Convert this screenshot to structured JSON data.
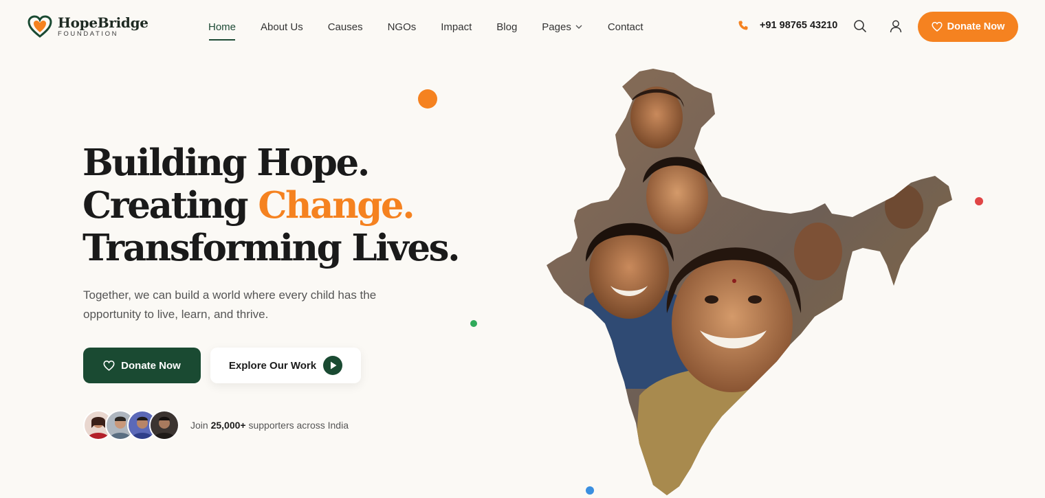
{
  "brand": {
    "name": "HopeBridge",
    "tagline": "FOUNDATION",
    "primary_color": "#1a4a32",
    "accent_color": "#f58220"
  },
  "nav": {
    "items": [
      {
        "label": "Home",
        "active": true
      },
      {
        "label": "About Us"
      },
      {
        "label": "Causes"
      },
      {
        "label": "NGOs"
      },
      {
        "label": "Impact"
      },
      {
        "label": "Blog"
      },
      {
        "label": "Pages",
        "has_dropdown": true
      },
      {
        "label": "Contact"
      }
    ]
  },
  "header": {
    "phone": "+91 98765 43210",
    "icons": [
      "phone-icon",
      "search-icon",
      "user-icon"
    ],
    "donate_label": "Donate Now"
  },
  "hero": {
    "title_line1": "Building Hope.",
    "title_line2_prefix": "Creating ",
    "title_line2_accent": "Change.",
    "title_line3": "Transforming Lives.",
    "subtitle": "Together, we can build a world where every child has the opportunity to live, learn, and thrive.",
    "donate_label": "Donate Now",
    "explore_label": "Explore Our Work",
    "supporters_prefix": "Join ",
    "supporters_count": "25,000+",
    "supporters_suffix": " supporters across India",
    "supporter_avatars": 4
  },
  "decor_colors": {
    "orange": "#f58220",
    "green": "#2faa5a",
    "red": "#e04545",
    "blue": "#3a8fe0"
  }
}
